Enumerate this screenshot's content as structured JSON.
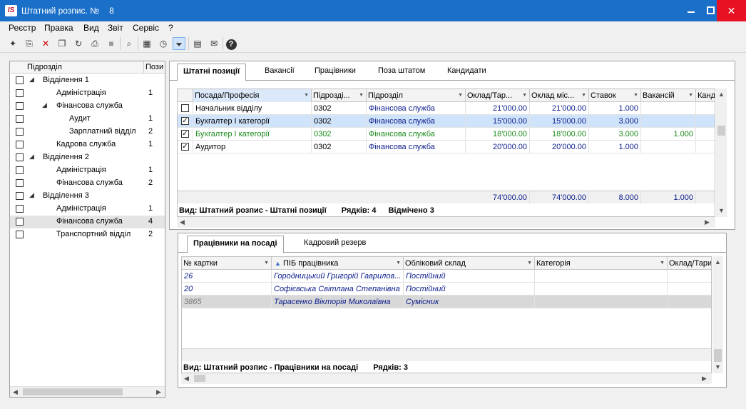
{
  "window": {
    "logo": "IS",
    "title": "Штатний розпис. №",
    "number": "8"
  },
  "menu": [
    "Реєстр",
    "Правка",
    "Вид",
    "Звіт",
    "Сервіс",
    "?"
  ],
  "toolbar_icons": [
    "new-doc-icon",
    "copy-doc-icon",
    "delete-doc-icon",
    "duplicate-icon",
    "refresh-icon",
    "print-icon",
    "export-icon",
    "search-icon",
    "table-icon",
    "clock-icon",
    "filter-icon",
    "notes-icon",
    "mail-icon",
    "help-icon"
  ],
  "tree": {
    "col_name": "Підрозділ",
    "col_count": "Пози",
    "items": [
      {
        "label": "Відділення 1",
        "level": 0,
        "expand": "◢",
        "count": ""
      },
      {
        "label": "Адміністрація",
        "level": 1,
        "expand": "",
        "count": "1"
      },
      {
        "label": "Фінансова служба",
        "level": 1,
        "expand": "◢",
        "count": ""
      },
      {
        "label": "Аудит",
        "level": 2,
        "expand": "",
        "count": "1"
      },
      {
        "label": "Зарплатний відділ",
        "level": 2,
        "expand": "",
        "count": "2"
      },
      {
        "label": "Кадрова служба",
        "level": 1,
        "expand": "",
        "count": "1"
      },
      {
        "label": "Відділення 2",
        "level": 0,
        "expand": "◢",
        "count": ""
      },
      {
        "label": "Адміністрація",
        "level": 1,
        "expand": "",
        "count": "1"
      },
      {
        "label": "Фінансова служба",
        "level": 1,
        "expand": "",
        "count": "2"
      },
      {
        "label": "Відділення 3",
        "level": 0,
        "expand": "◢",
        "count": ""
      },
      {
        "label": "Адміністрація",
        "level": 1,
        "expand": "",
        "count": "1"
      },
      {
        "label": "Фінансова служба",
        "level": 1,
        "expand": "",
        "count": "4"
      },
      {
        "label": "Транспортний відділ",
        "level": 1,
        "expand": "",
        "count": "2"
      }
    ]
  },
  "top_tabs": [
    "Штатні позиції",
    "Вакансії",
    "Працівники",
    "Поза штатом",
    "Кандидати"
  ],
  "positions": {
    "columns": [
      "Посада/Професія",
      "Підрозді...",
      "Підрозділ",
      "Оклад/Тар...",
      "Оклад міс...",
      "Ставок",
      "Вакансій",
      "Канд"
    ],
    "rows": [
      {
        "checked": false,
        "name": "Начальник відділу",
        "code": "0302",
        "dept": "Фінансова служба",
        "rate": "21'000.00",
        "monthly": "21'000.00",
        "stavok": "1.000",
        "vac": "",
        "style": "normal"
      },
      {
        "checked": true,
        "name": "Бухгалтер І категорії",
        "code": "0302",
        "dept": "Фінансова служба",
        "rate": "15'000.00",
        "monthly": "15'000.00",
        "stavok": "3.000",
        "vac": "",
        "style": "selected"
      },
      {
        "checked": true,
        "name": "Бухгалтер І категорії",
        "code": "0302",
        "dept": "Фінансова служба",
        "rate": "18'000.00",
        "monthly": "18'000.00",
        "stavok": "3.000",
        "vac": "1.000",
        "style": "green"
      },
      {
        "checked": true,
        "name": "Аудитор",
        "code": "0302",
        "dept": "Фінансова служба",
        "rate": "20'000.00",
        "monthly": "20'000.00",
        "stavok": "1.000",
        "vac": "",
        "style": "normal"
      }
    ],
    "totals": {
      "rate": "74'000.00",
      "monthly": "74'000.00",
      "stavok": "8.000",
      "vac": "1.000"
    },
    "status": "Вид: Штатний розпис - Штатні позиції",
    "rows_label": "Рядків: 4",
    "marked_label": "Відмічено 3"
  },
  "bottom_tabs": [
    "Працівники на посаді",
    "Кадровий резерв"
  ],
  "employees": {
    "columns": [
      "№ картки",
      "ПІБ працівника",
      "Обліковий склад",
      "Категорія",
      "Оклад/Тари"
    ],
    "rows": [
      {
        "card": "26",
        "name": "Городницький Григорій Гаврилов...",
        "staff": "Постійний",
        "style": "normal"
      },
      {
        "card": "20",
        "name": "Софієвська Світлана Степанівна",
        "staff": "Постійний",
        "style": "normal"
      },
      {
        "card": "3865",
        "name": "Тарасенко Вікторія Миколаївна",
        "staff": "Сумісник",
        "style": "gray"
      }
    ],
    "status": "Вид: Штатний розпис - Працівники на посаді",
    "rows_label": "Рядків: 3"
  }
}
